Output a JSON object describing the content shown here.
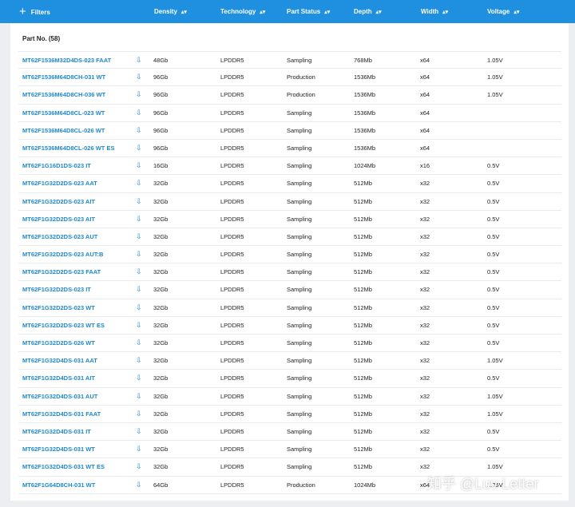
{
  "header": {
    "filters_label": "Filters",
    "plus_icon": "+",
    "sort_icon": "▴▾",
    "columns": [
      "Density",
      "Technology",
      "Part Status",
      "Depth",
      "Width",
      "Voltage"
    ]
  },
  "table": {
    "title": "Part No. (58)",
    "download_icon": "⇩",
    "rows": [
      {
        "part": "MT62F1536M32D4DS-023 FAAT",
        "density": "48Gb",
        "technology": "LPDDR5",
        "status": "Sampling",
        "depth": "768Mb",
        "width": "x64",
        "voltage": "1.05V"
      },
      {
        "part": "MT62F1536M64D8CH-031 WT",
        "density": "96Gb",
        "technology": "LPDDR5",
        "status": "Production",
        "depth": "1536Mb",
        "width": "x64",
        "voltage": "1.05V"
      },
      {
        "part": "MT62F1536M64D8CH-036 WT",
        "density": "96Gb",
        "technology": "LPDDR5",
        "status": "Production",
        "depth": "1536Mb",
        "width": "x64",
        "voltage": "1.05V"
      },
      {
        "part": "MT62F1536M64D8CL-023 WT",
        "density": "96Gb",
        "technology": "LPDDR5",
        "status": "Sampling",
        "depth": "1536Mb",
        "width": "x64",
        "voltage": ""
      },
      {
        "part": "MT62F1536M64D8CL-026 WT",
        "density": "96Gb",
        "technology": "LPDDR5",
        "status": "Sampling",
        "depth": "1536Mb",
        "width": "x64",
        "voltage": ""
      },
      {
        "part": "MT62F1536M64D8CL-026 WT ES",
        "density": "96Gb",
        "technology": "LPDDR5",
        "status": "Sampling",
        "depth": "1536Mb",
        "width": "x64",
        "voltage": ""
      },
      {
        "part": "MT62F1G16D1DS-023 IT",
        "density": "16Gb",
        "technology": "LPDDR5",
        "status": "Sampling",
        "depth": "1024Mb",
        "width": "x16",
        "voltage": "0.5V"
      },
      {
        "part": "MT62F1G32D2DS-023 AAT",
        "density": "32Gb",
        "technology": "LPDDR5",
        "status": "Sampling",
        "depth": "512Mb",
        "width": "x32",
        "voltage": "0.5V"
      },
      {
        "part": "MT62F1G32D2DS-023 AIT",
        "density": "32Gb",
        "technology": "LPDDR5",
        "status": "Sampling",
        "depth": "512Mb",
        "width": "x32",
        "voltage": "0.5V"
      },
      {
        "part": "MT62F1G32D2DS-023 AIT",
        "density": "32Gb",
        "technology": "LPDDR5",
        "status": "Sampling",
        "depth": "512Mb",
        "width": "x32",
        "voltage": "0.5V"
      },
      {
        "part": "MT62F1G32D2DS-023 AUT",
        "density": "32Gb",
        "technology": "LPDDR5",
        "status": "Sampling",
        "depth": "512Mb",
        "width": "x32",
        "voltage": "0.5V"
      },
      {
        "part": "MT62F1G32D2DS-023 AUT:B",
        "density": "32Gb",
        "technology": "LPDDR5",
        "status": "Sampling",
        "depth": "512Mb",
        "width": "x32",
        "voltage": "0.5V"
      },
      {
        "part": "MT62F1G32D2DS-023 FAAT",
        "density": "32Gb",
        "technology": "LPDDR5",
        "status": "Sampling",
        "depth": "512Mb",
        "width": "x32",
        "voltage": "0.5V"
      },
      {
        "part": "MT62F1G32D2DS-023 IT",
        "density": "32Gb",
        "technology": "LPDDR5",
        "status": "Sampling",
        "depth": "512Mb",
        "width": "x32",
        "voltage": "0.5V"
      },
      {
        "part": "MT62F1G32D2DS-023 WT",
        "density": "32Gb",
        "technology": "LPDDR5",
        "status": "Sampling",
        "depth": "512Mb",
        "width": "x32",
        "voltage": "0.5V"
      },
      {
        "part": "MT62F1G32D2DS-023 WT ES",
        "density": "32Gb",
        "technology": "LPDDR5",
        "status": "Sampling",
        "depth": "512Mb",
        "width": "x32",
        "voltage": "0.5V"
      },
      {
        "part": "MT62F1G32D2DS-026 WT",
        "density": "32Gb",
        "technology": "LPDDR5",
        "status": "Sampling",
        "depth": "512Mb",
        "width": "x32",
        "voltage": "0.5V"
      },
      {
        "part": "MT62F1G32D4DS-031 AAT",
        "density": "32Gb",
        "technology": "LPDDR5",
        "status": "Sampling",
        "depth": "512Mb",
        "width": "x32",
        "voltage": "1.05V"
      },
      {
        "part": "MT62F1G32D4DS-031 AIT",
        "density": "32Gb",
        "technology": "LPDDR5",
        "status": "Sampling",
        "depth": "512Mb",
        "width": "x32",
        "voltage": "0.5V"
      },
      {
        "part": "MT62F1G32D4DS-031 AUT",
        "density": "32Gb",
        "technology": "LPDDR5",
        "status": "Sampling",
        "depth": "512Mb",
        "width": "x32",
        "voltage": "1.05V"
      },
      {
        "part": "MT62F1G32D4DS-031 FAAT",
        "density": "32Gb",
        "technology": "LPDDR5",
        "status": "Sampling",
        "depth": "512Mb",
        "width": "x32",
        "voltage": "1.05V"
      },
      {
        "part": "MT62F1G32D4DS-031 IT",
        "density": "32Gb",
        "technology": "LPDDR5",
        "status": "Sampling",
        "depth": "512Mb",
        "width": "x32",
        "voltage": "0.5V"
      },
      {
        "part": "MT62F1G32D4DS-031 WT",
        "density": "32Gb",
        "technology": "LPDDR5",
        "status": "Sampling",
        "depth": "512Mb",
        "width": "x32",
        "voltage": "0.5V"
      },
      {
        "part": "MT62F1G32D4DS-031 WT ES",
        "density": "32Gb",
        "technology": "LPDDR5",
        "status": "Sampling",
        "depth": "512Mb",
        "width": "x32",
        "voltage": "1.05V"
      },
      {
        "part": "MT62F1G64D8CH-031 WT",
        "density": "64Gb",
        "technology": "LPDDR5",
        "status": "Production",
        "depth": "1024Mb",
        "width": "x64",
        "voltage": "1.05V"
      }
    ]
  },
  "watermark": "知乎 @Luv Letter",
  "colors": {
    "header_bg": "#1f8fe0",
    "link": "#1e88cf",
    "page_bg": "#eceef1"
  }
}
